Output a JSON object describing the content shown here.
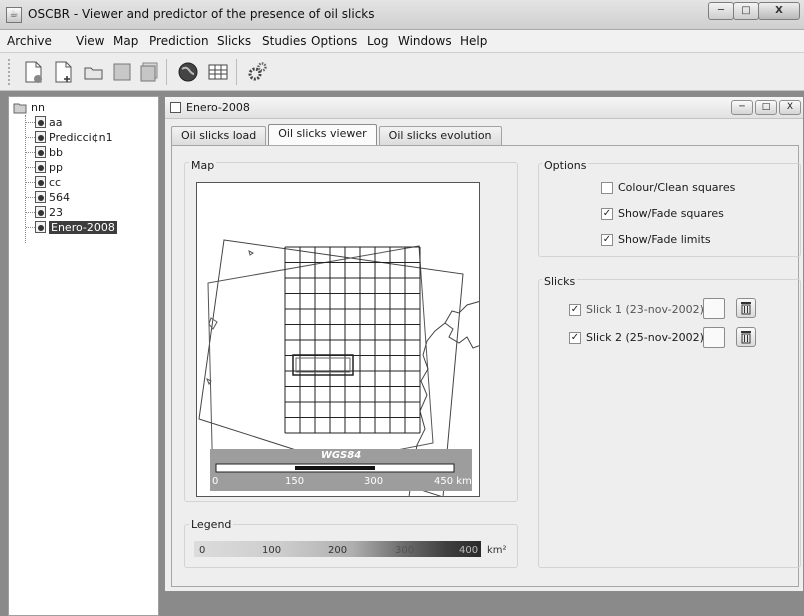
{
  "window": {
    "title": "OSCBR - Viewer and predictor of the presence of oil slicks",
    "minimize": "─",
    "maximize": "□",
    "close": "X"
  },
  "menu": [
    "Archive",
    "View",
    "Map",
    "Prediction",
    "Slicks",
    "Studies",
    "Options",
    "Log",
    "Windows",
    "Help"
  ],
  "toolbar": {
    "icons": [
      "new-study-icon",
      "new-document-icon",
      "open-folder-icon",
      "save-icon",
      "save-as-icon",
      "globe-icon",
      "grid-icon",
      "settings-gears-icon"
    ]
  },
  "tree": {
    "root": "nn",
    "items": [
      "aa",
      "Predicci¢n1",
      "bb",
      "pp",
      "cc",
      "564",
      "23",
      "Enero-2008"
    ],
    "selected": "Enero-2008"
  },
  "internal_window": {
    "title": "Enero-2008",
    "tabs": [
      "Oil slicks load",
      "Oil slicks viewer",
      "Oil slicks evolution"
    ],
    "active_tab": "Oil slicks viewer"
  },
  "map": {
    "label": "Map",
    "scale_title": "WGS84",
    "scale_ticks": [
      "0",
      "150",
      "300",
      "450 km"
    ]
  },
  "options": {
    "label": "Options",
    "items": [
      {
        "label": "Colour/Clean squares",
        "checked": false
      },
      {
        "label": "Show/Fade squares",
        "checked": true
      },
      {
        "label": "Show/Fade limits",
        "checked": true
      }
    ]
  },
  "slicks": {
    "label": "Slicks",
    "items": [
      {
        "label": "Slick 1 (23-nov-2002)",
        "checked": true
      },
      {
        "label": "Slick 2 (25-nov-2002)",
        "checked": true
      }
    ]
  },
  "legend": {
    "label": "Legend",
    "ticks": [
      "0",
      "100",
      "200",
      "300",
      "400"
    ],
    "unit": "km²"
  }
}
